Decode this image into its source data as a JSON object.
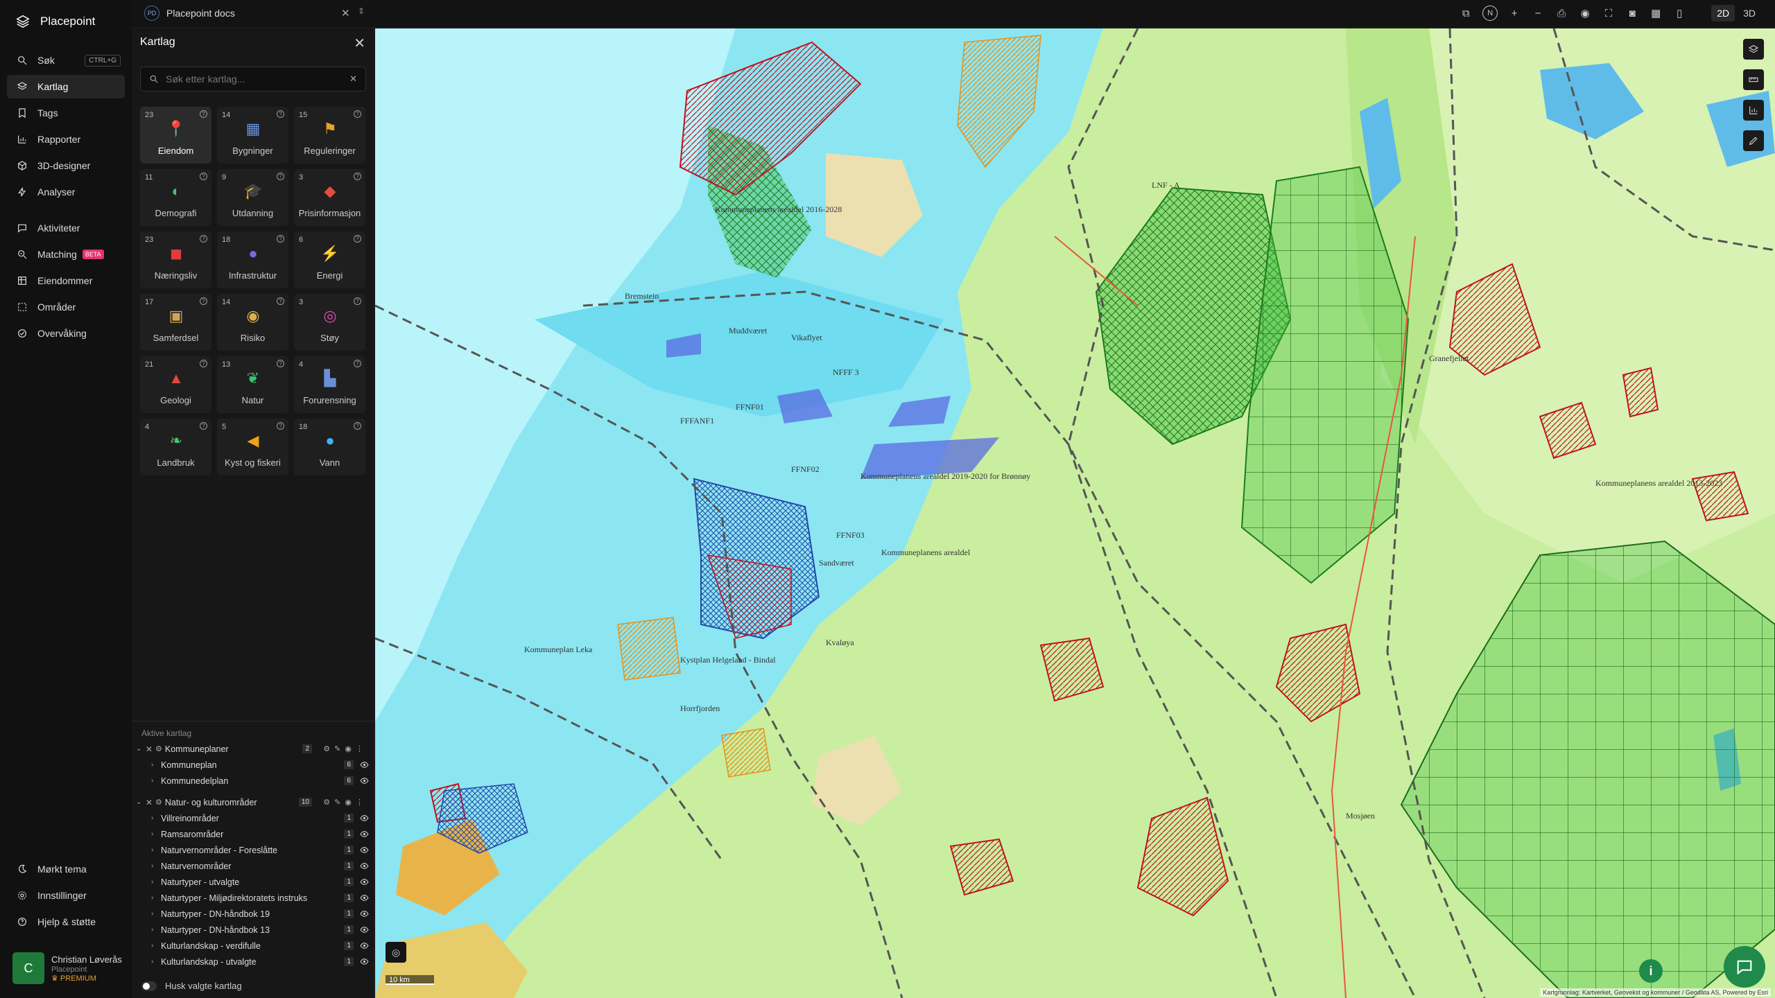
{
  "app": {
    "name": "Placepoint"
  },
  "nav": {
    "items": [
      {
        "label": "Søk",
        "shortcut": "CTRL+G"
      },
      {
        "label": "Kartlag"
      },
      {
        "label": "Tags"
      },
      {
        "label": "Rapporter"
      },
      {
        "label": "3D-designer"
      },
      {
        "label": "Analyser"
      },
      {
        "label": "Aktiviteter"
      },
      {
        "label": "Matching",
        "badge": "BETA"
      },
      {
        "label": "Eiendommer"
      },
      {
        "label": "Områder"
      },
      {
        "label": "Overvåking"
      }
    ],
    "bottom": [
      {
        "label": "Mørkt tema"
      },
      {
        "label": "Innstillinger"
      },
      {
        "label": "Hjelp & støtte"
      }
    ],
    "user": {
      "initial": "C",
      "name": "Christian Løverås",
      "org": "Placepoint",
      "plan": "PREMIUM"
    }
  },
  "topbar": {
    "doc_badge": "PD",
    "doc_title": "Placepoint docs",
    "north": "N",
    "view_2d": "2D",
    "view_3d": "3D",
    "tools": [
      "layers-icon",
      "north-icon",
      "zoom-in-icon",
      "zoom-out-icon",
      "print-icon",
      "eye-icon",
      "fullscreen-icon",
      "camera-icon",
      "grid-icon",
      "bookmark-icon"
    ]
  },
  "panel": {
    "title": "Kartlag",
    "search_placeholder": "Søk etter kartlag...",
    "categories": [
      {
        "count": "23",
        "label": "Eiendom",
        "icon": "pin-icon",
        "color": "#e23b3b"
      },
      {
        "count": "14",
        "label": "Bygninger",
        "icon": "building-icon",
        "color": "#6a8fd8"
      },
      {
        "count": "15",
        "label": "Reguleringer",
        "icon": "signpost-icon",
        "color": "#e5a12a"
      },
      {
        "count": "11",
        "label": "Demografi",
        "icon": "demographics-icon",
        "color": "#4cc36b"
      },
      {
        "count": "9",
        "label": "Utdanning",
        "icon": "graduation-icon",
        "color": "#3c7fd8"
      },
      {
        "count": "3",
        "label": "Prisinformasjon",
        "icon": "price-tag-icon",
        "color": "#e2503b"
      },
      {
        "count": "23",
        "label": "Næringsliv",
        "icon": "shop-icon",
        "color": "#e23b3b"
      },
      {
        "count": "18",
        "label": "Infrastruktur",
        "icon": "globe-icon",
        "color": "#7a6ae0"
      },
      {
        "count": "6",
        "label": "Energi",
        "icon": "bolt-icon",
        "color": "#f2c315"
      },
      {
        "count": "17",
        "label": "Samferdsel",
        "icon": "bus-icon",
        "color": "#c9a65a"
      },
      {
        "count": "14",
        "label": "Risiko",
        "icon": "hazard-icon",
        "color": "#d8b24a"
      },
      {
        "count": "3",
        "label": "Støy",
        "icon": "noise-icon",
        "color": "#e24ab4"
      },
      {
        "count": "21",
        "label": "Geologi",
        "icon": "geology-icon",
        "color": "#d84a3b"
      },
      {
        "count": "13",
        "label": "Natur",
        "icon": "leaf-icon",
        "color": "#3cc36b"
      },
      {
        "count": "4",
        "label": "Forurensning",
        "icon": "factory-icon",
        "color": "#6a8fd8"
      },
      {
        "count": "4",
        "label": "Landbruk",
        "icon": "sprout-icon",
        "color": "#4cc36b"
      },
      {
        "count": "5",
        "label": "Kyst og fiskeri",
        "icon": "fish-icon",
        "color": "#f2a215"
      },
      {
        "count": "18",
        "label": "Vann",
        "icon": "drop-icon",
        "color": "#3cb4f2"
      }
    ],
    "active_title": "Aktive kartlag",
    "groups": [
      {
        "label": "Kommuneplaner",
        "count": "2",
        "layers": [
          {
            "label": "Kommuneplan",
            "count": "6"
          },
          {
            "label": "Kommunedelplan",
            "count": "6"
          }
        ]
      },
      {
        "label": "Natur- og kulturområder",
        "count": "10",
        "layers": [
          {
            "label": "Villreinområder",
            "count": "1"
          },
          {
            "label": "Ramsarområder",
            "count": "1"
          },
          {
            "label": "Naturvernområder - Foreslåtte",
            "count": "1"
          },
          {
            "label": "Naturvernområder",
            "count": "1"
          },
          {
            "label": "Naturtyper - utvalgte",
            "count": "1"
          },
          {
            "label": "Naturtyper - Miljødirektoratets instruks",
            "count": "1"
          },
          {
            "label": "Naturtyper - DN-håndbok 19",
            "count": "1"
          },
          {
            "label": "Naturtyper - DN-håndbok 13",
            "count": "1"
          },
          {
            "label": "Kulturlandskap - verdifulle",
            "count": "1"
          },
          {
            "label": "Kulturlandskap - utvalgte",
            "count": "1"
          }
        ]
      }
    ],
    "remember_label": "Husk valgte kartlag"
  },
  "map": {
    "scale": "10 km",
    "attribution": "Kartgrunnlag: Kartverket, Geovekst og kommuner / Geodata AS, Powered by Esri",
    "labels": [
      "Kommuneplanens arealdel 2016-2028",
      "Kommuneplanens arealdel 2019-2020 for Brønnøy",
      "Kommuneplanens arealdel",
      "Kommuneplan Leka",
      "Kystplan Helgeland - Bindal",
      "Horrfjorden",
      "Sandværet",
      "Kvaløya",
      "Bremstein",
      "Muddværet",
      "Vikaflyet",
      "Kommuneplanens arealdel 2013-2023",
      "FFFANF1",
      "FFNF01",
      "FFNF02",
      "FFNF03",
      "NFFF 3",
      "LNF - A",
      "Granefjellet",
      "Mosjøen"
    ]
  }
}
